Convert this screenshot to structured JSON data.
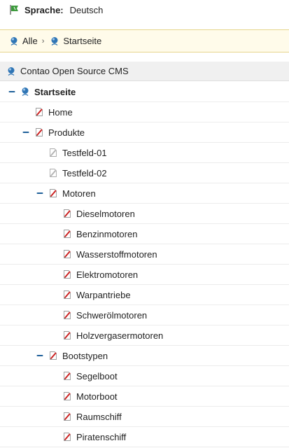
{
  "language_bar": {
    "label": "Sprache:",
    "value": "Deutsch"
  },
  "breadcrumb": {
    "items": [
      "Alle",
      "Startseite"
    ],
    "separator": "›"
  },
  "tree_root": {
    "label": "Contao Open Source CMS"
  },
  "tree": {
    "rows": [
      {
        "label": "Startseite",
        "level": 0,
        "icon": "globe-icon",
        "toggle": "collapse",
        "bold": true
      },
      {
        "label": "Home",
        "level": 1,
        "icon": "page-edit-icon",
        "toggle": null
      },
      {
        "label": "Produkte",
        "level": 1,
        "icon": "page-edit-icon",
        "toggle": "collapse"
      },
      {
        "label": "Testfeld-01",
        "level": 2,
        "icon": "page-grey-icon",
        "toggle": null
      },
      {
        "label": "Testfeld-02",
        "level": 2,
        "icon": "page-grey-icon",
        "toggle": null
      },
      {
        "label": "Motoren",
        "level": 2,
        "icon": "page-edit-icon",
        "toggle": "collapse"
      },
      {
        "label": "Dieselmotoren",
        "level": 3,
        "icon": "page-edit-icon",
        "toggle": null
      },
      {
        "label": "Benzinmotoren",
        "level": 3,
        "icon": "page-edit-icon",
        "toggle": null
      },
      {
        "label": "Wasserstoffmotoren",
        "level": 3,
        "icon": "page-edit-icon",
        "toggle": null
      },
      {
        "label": "Elektromotoren",
        "level": 3,
        "icon": "page-edit-icon",
        "toggle": null
      },
      {
        "label": "Warpantriebe",
        "level": 3,
        "icon": "page-edit-icon",
        "toggle": null
      },
      {
        "label": "Schwerölmotoren",
        "level": 3,
        "icon": "page-edit-icon",
        "toggle": null
      },
      {
        "label": "Holzvergasermotoren",
        "level": 3,
        "icon": "page-edit-icon",
        "toggle": null
      },
      {
        "label": "Bootstypen",
        "level": 2,
        "icon": "page-edit-icon",
        "toggle": "collapse"
      },
      {
        "label": "Segelboot",
        "level": 3,
        "icon": "page-edit-icon",
        "toggle": null
      },
      {
        "label": "Motorboot",
        "level": 3,
        "icon": "page-edit-icon",
        "toggle": null
      },
      {
        "label": "Raumschiff",
        "level": 3,
        "icon": "page-edit-icon",
        "toggle": null
      },
      {
        "label": "Piratenschiff",
        "level": 3,
        "icon": "page-edit-icon",
        "toggle": null
      }
    ]
  },
  "colors": {
    "breadcrumb_bg": "#fffbea",
    "breadcrumb_border": "#e6d58c",
    "root_bg": "#f0f0f0",
    "accent_blue": "#1e5f99",
    "edit_red": "#cc2222",
    "flag_green": "#3c9a3c"
  }
}
